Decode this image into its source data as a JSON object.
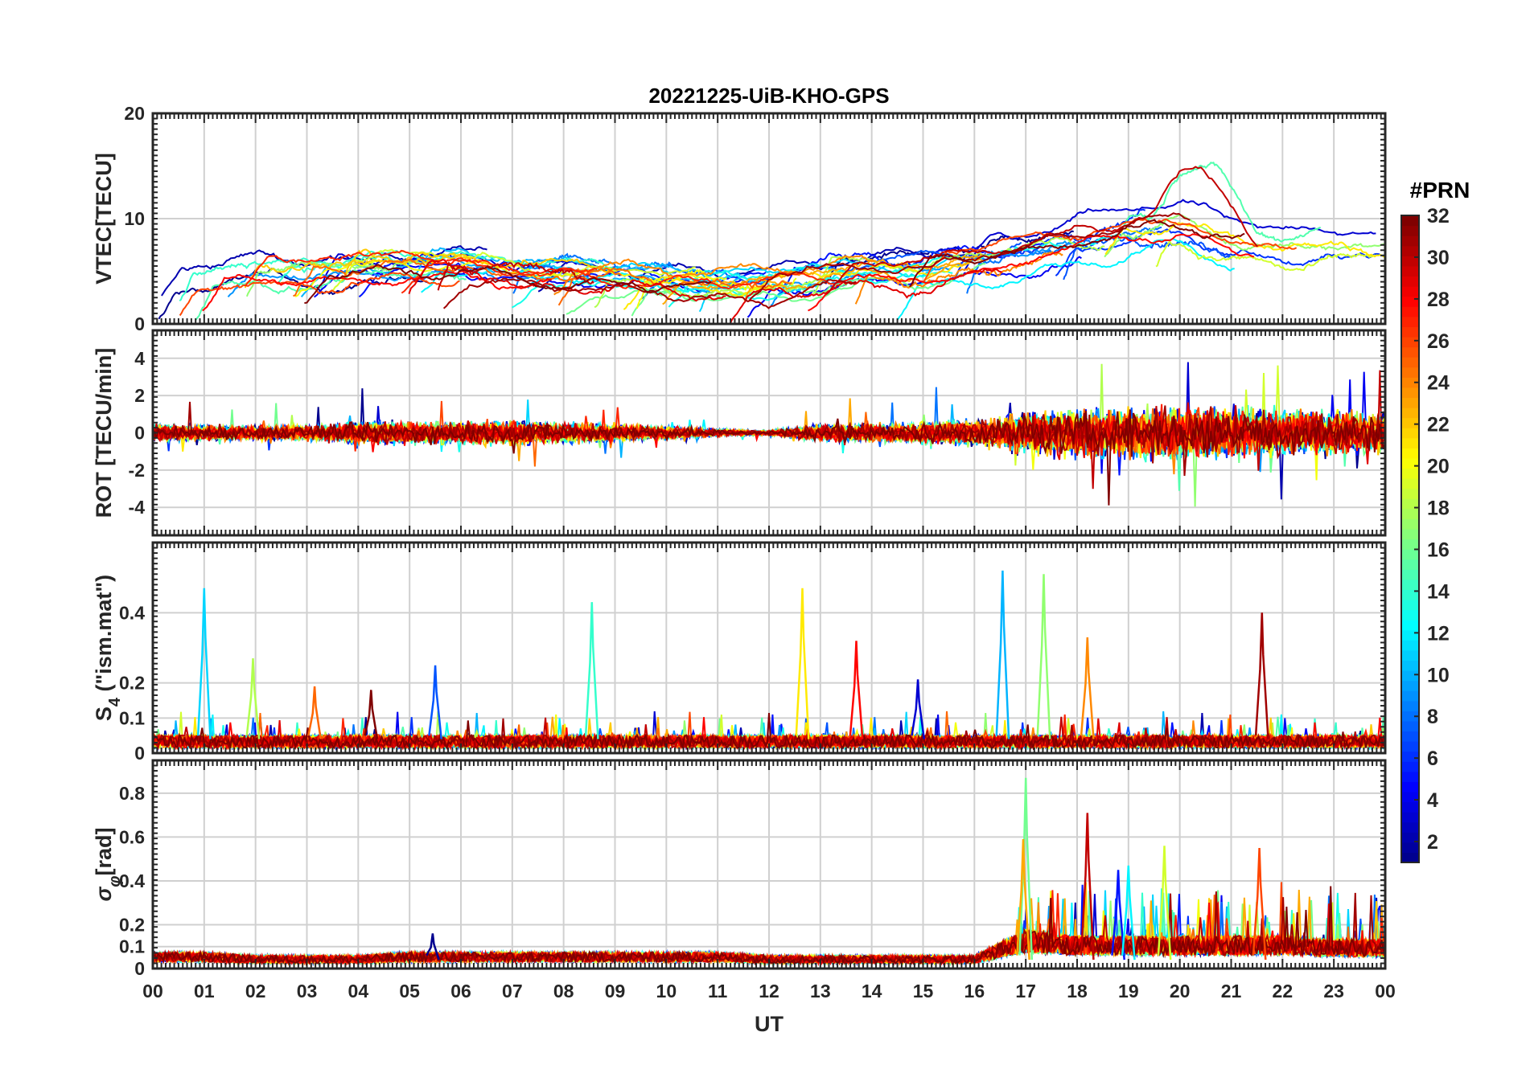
{
  "chart_data": {
    "type": "line",
    "title": "20221225-UiB-KHO-GPS",
    "xlabel": "UT",
    "x_ticks": [
      "00",
      "01",
      "02",
      "03",
      "04",
      "05",
      "06",
      "07",
      "08",
      "09",
      "10",
      "11",
      "12",
      "13",
      "14",
      "15",
      "16",
      "17",
      "18",
      "19",
      "20",
      "21",
      "22",
      "23",
      "00"
    ],
    "xlim_hours": [
      0,
      24
    ],
    "grid": true,
    "series_per_panel": 32,
    "colorbar": {
      "title": "#PRN",
      "range": [
        1,
        32
      ],
      "ticks": [
        "2",
        "4",
        "6",
        "8",
        "10",
        "12",
        "14",
        "16",
        "18",
        "20",
        "22",
        "24",
        "26",
        "28",
        "30",
        "32"
      ],
      "colormap": "jet",
      "colors": [
        "#00008f",
        "#0000ff",
        "#0080ff",
        "#00ffff",
        "#80ff80",
        "#ffff00",
        "#ff8000",
        "#ff0000",
        "#800000"
      ]
    },
    "panels": [
      {
        "id": "vtec",
        "ylabel": "VTEC[TECU]",
        "ylim": [
          0,
          20
        ],
        "y_ticks": [
          "0",
          "10",
          "20"
        ],
        "summary": {
          "baseline": [
            3.5,
            4.5,
            5.0,
            5.0,
            5.2,
            5.5,
            5.3,
            4.8,
            4.5,
            4.3,
            4.0,
            3.8,
            4.0,
            4.6,
            5.0,
            5.0,
            5.8,
            6.5,
            7.8,
            8.5,
            9.5,
            7.5,
            6.5,
            7.0,
            7.0
          ],
          "spread": 1.5
        }
      },
      {
        "id": "rot",
        "ylabel": "ROT [TECU/min]",
        "ylim": [
          -5.5,
          5.5
        ],
        "y_ticks": [
          "-4",
          "-2",
          "0",
          "2",
          "4"
        ],
        "summary": {
          "noise_std_by_hour": [
            0.35,
            0.3,
            0.3,
            0.3,
            0.45,
            0.45,
            0.45,
            0.5,
            0.4,
            0.35,
            0.25,
            0.15,
            0.1,
            0.35,
            0.35,
            0.45,
            0.5,
            0.85,
            0.95,
            1.0,
            1.0,
            1.0,
            0.9,
            0.85,
            0.8
          ]
        }
      },
      {
        "id": "s4",
        "ylabel": "S4 (\"ism.mat\")",
        "ylabel_main": "S",
        "ylabel_sub": "4",
        "ylabel_rest": " (\"ism.mat\")",
        "ylim": [
          0,
          0.6
        ],
        "y_ticks": [
          "0",
          "0.1",
          "0.2",
          "0.4"
        ],
        "summary": {
          "baseline": 0.03,
          "spikes": [
            {
              "t": 1.0,
              "v": 0.47
            },
            {
              "t": 1.95,
              "v": 0.27
            },
            {
              "t": 3.15,
              "v": 0.19
            },
            {
              "t": 4.25,
              "v": 0.18
            },
            {
              "t": 5.5,
              "v": 0.25
            },
            {
              "t": 8.55,
              "v": 0.43
            },
            {
              "t": 12.65,
              "v": 0.47
            },
            {
              "t": 13.7,
              "v": 0.32
            },
            {
              "t": 14.9,
              "v": 0.21
            },
            {
              "t": 16.55,
              "v": 0.52
            },
            {
              "t": 17.35,
              "v": 0.51
            },
            {
              "t": 18.2,
              "v": 0.33
            },
            {
              "t": 21.6,
              "v": 0.4
            }
          ]
        }
      },
      {
        "id": "sigma_phi",
        "ylabel": "σφ[rad]",
        "ylabel_main": "σ",
        "ylabel_sub": "φ",
        "ylabel_rest": "[rad]",
        "ylim": [
          0,
          0.95
        ],
        "y_ticks": [
          "0",
          "0.1",
          "0.2",
          "0.4",
          "0.6",
          "0.8"
        ],
        "summary": {
          "baseline_by_hour": [
            0.05,
            0.05,
            0.04,
            0.04,
            0.04,
            0.05,
            0.05,
            0.05,
            0.05,
            0.05,
            0.05,
            0.05,
            0.04,
            0.04,
            0.04,
            0.04,
            0.04,
            0.12,
            0.1,
            0.1,
            0.1,
            0.1,
            0.1,
            0.09,
            0.09
          ],
          "spikes": [
            {
              "t": 17.0,
              "v": 0.87
            },
            {
              "t": 16.95,
              "v": 0.59
            },
            {
              "t": 18.2,
              "v": 0.71
            },
            {
              "t": 18.8,
              "v": 0.45
            },
            {
              "t": 19.0,
              "v": 0.47
            },
            {
              "t": 19.7,
              "v": 0.56
            },
            {
              "t": 21.55,
              "v": 0.55
            },
            {
              "t": 5.45,
              "v": 0.16
            }
          ]
        }
      }
    ]
  }
}
